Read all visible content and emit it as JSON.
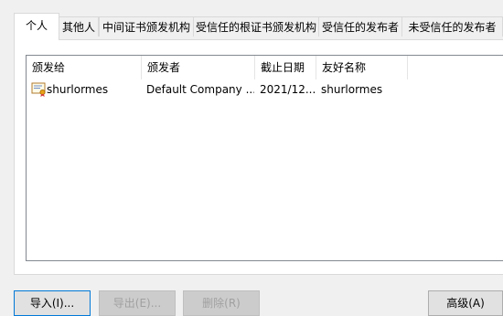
{
  "tabs": [
    {
      "label": "个人"
    },
    {
      "label": "其他人"
    },
    {
      "label": "中间证书颁发机构"
    },
    {
      "label": "受信任的根证书颁发机构"
    },
    {
      "label": "受信任的发布者"
    },
    {
      "label": "未受信任的发布者"
    }
  ],
  "list": {
    "columns": [
      "颁发给",
      "颁发者",
      "截止日期",
      "友好名称"
    ],
    "rows": [
      {
        "issued_to": "shurlormes",
        "issued_by": "Default Company ...",
        "expiry": "2021/12...",
        "friendly_name": "shurlormes",
        "icon": "certificate-icon"
      }
    ]
  },
  "buttons": {
    "import": "导入(I)...",
    "export": "导出(E)...",
    "remove": "删除(R)",
    "advanced": "高级(A)"
  },
  "colors": {
    "list_border": "#828790",
    "primary_border": "#0078d7",
    "disabled_text": "#a0a0a0"
  }
}
